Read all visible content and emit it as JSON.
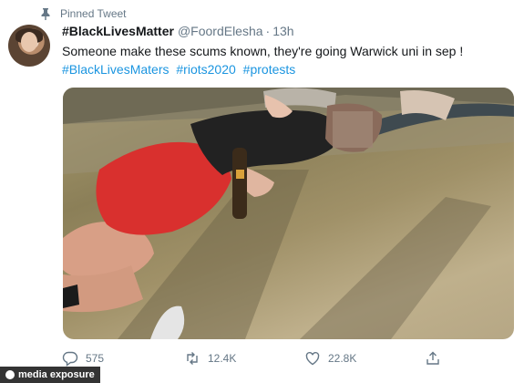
{
  "pinned": {
    "label": "Pinned Tweet",
    "icon": "pin-icon"
  },
  "tweet": {
    "display_name": "#BlackLivesMatter",
    "handle": "@FoordElesha",
    "separator": "·",
    "timestamp": "13h",
    "text": "Someone make these scums known, they're going Warwick uni in sep !",
    "hashtags": [
      "#BlackLivesMaters",
      "#riots2020",
      "#protests"
    ],
    "hashtag_color": "#1b95e0"
  },
  "media": {
    "description_icon": "photo-icon"
  },
  "actions": {
    "reply": {
      "icon": "reply-icon",
      "count": "575"
    },
    "retweet": {
      "icon": "retweet-icon",
      "count": "12.4K"
    },
    "like": {
      "icon": "heart-icon",
      "count": "22.8K"
    },
    "share": {
      "icon": "share-icon"
    }
  },
  "watermark": {
    "text": "media exposure"
  }
}
